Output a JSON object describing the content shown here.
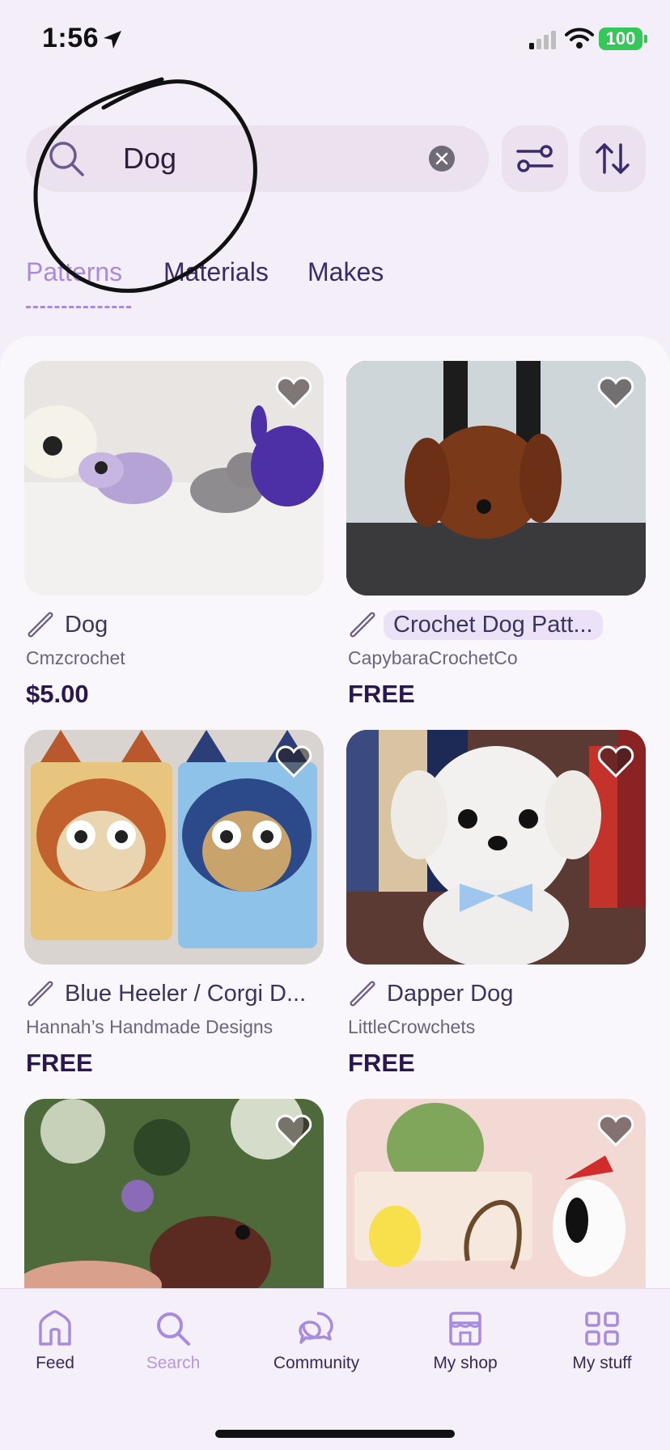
{
  "status_bar": {
    "time": "1:56",
    "battery": "100",
    "location_icon": "location-arrow-icon",
    "signal_icon": "cellular-signal-icon",
    "wifi_icon": "wifi-icon"
  },
  "search": {
    "value": "Dog",
    "search_icon": "search-icon",
    "clear_icon": "clear-icon",
    "filter_icon": "filter-sliders-icon",
    "sort_icon": "sort-arrows-icon"
  },
  "tabs": [
    {
      "label": "Patterns",
      "active": true
    },
    {
      "label": "Materials",
      "active": false
    },
    {
      "label": "Makes",
      "active": false
    }
  ],
  "results": [
    {
      "title": "Dog",
      "author": "Cmzcrochet",
      "price": "$5.00",
      "type_icon": "crochet-hook-icon",
      "favorite": false
    },
    {
      "title": "Crochet Dog Patt...",
      "author": "CapybaraCrochetCo",
      "price": "FREE",
      "type_icon": "crochet-hook-icon",
      "favorite": false
    },
    {
      "title": "Blue Heeler / Corgi D...",
      "author": "Hannah’s Handmade Designs",
      "price": "FREE",
      "type_icon": "crochet-hook-icon",
      "favorite": false
    },
    {
      "title": "Dapper Dog",
      "author": "LittleCrowchets",
      "price": "FREE",
      "type_icon": "crochet-hook-icon",
      "favorite": false
    },
    {
      "title": "",
      "author": "",
      "price": "",
      "type_icon": "crochet-hook-icon",
      "favorite": false
    },
    {
      "title": "",
      "author": "",
      "price": "",
      "type_icon": "crochet-hook-icon",
      "favorite": false
    }
  ],
  "nav": [
    {
      "label": "Feed",
      "icon": "home-icon",
      "active": false
    },
    {
      "label": "Search",
      "icon": "search-icon",
      "active": true
    },
    {
      "label": "Community",
      "icon": "chat-bubbles-icon",
      "active": false
    },
    {
      "label": "My shop",
      "icon": "shop-icon",
      "active": false
    },
    {
      "label": "My stuff",
      "icon": "grid-icon",
      "active": false
    }
  ],
  "colors": {
    "accent": "#a78be0",
    "nav_active": "#b597e6",
    "text_dark": "#2a1750",
    "chip_bg": "#ece2ef",
    "battery": "#35c759"
  }
}
